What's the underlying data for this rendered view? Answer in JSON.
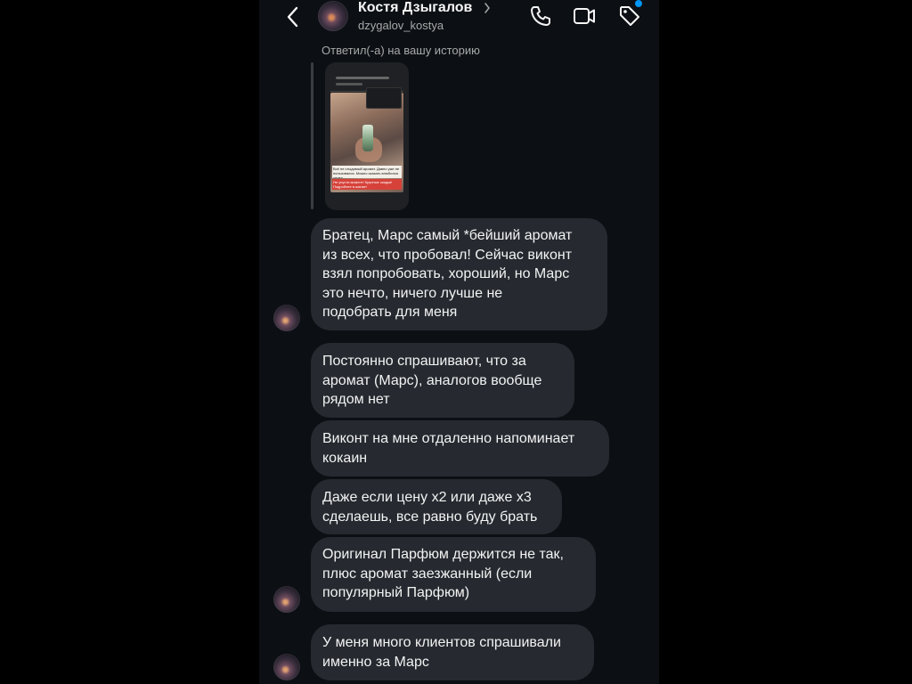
{
  "header": {
    "name": "Костя Дзыгалов",
    "username": "dzygalov_kostya"
  },
  "story_reply": {
    "label": "Ответил(-а) на вашу историю",
    "caption": "Всё не стыдимый аромат. Давно уже не пользовался. Можно сказать влюбился снова",
    "caption_red": "Не упусти момент! Крупные скидки! Подробнее в шапке!"
  },
  "messages": [
    {
      "text": "Братец, Марс самый *бейший аромат\nиз всех, что пробовал! Сейчас виконт\nвзял попробовать, хороший, но Марс\nэто нечто, ничего лучше не\nподобрать для меня"
    },
    {
      "text": "Постоянно спрашивают, что за\nаромат (Марс), аналогов вообще\nрядом нет"
    },
    {
      "text": "Виконт на мне отдаленно напоминает\nкокаин"
    },
    {
      "text": "Даже если цену х2 или даже х3\nсделаешь, все равно буду брать"
    },
    {
      "text": "Оригинал Парфюм держится не так,\nплюс аромат заезжанный (если\nпопулярный Парфюм)"
    },
    {
      "text": "У меня много клиентов спрашивали\nименно за Марс"
    }
  ],
  "colors": {
    "background": "#0c1014",
    "bubble": "#262a30",
    "accent": "#0095f6"
  },
  "icons": [
    "back-arrow-icon",
    "chevron-right-icon",
    "phone-icon",
    "video-camera-icon",
    "tag-icon"
  ]
}
